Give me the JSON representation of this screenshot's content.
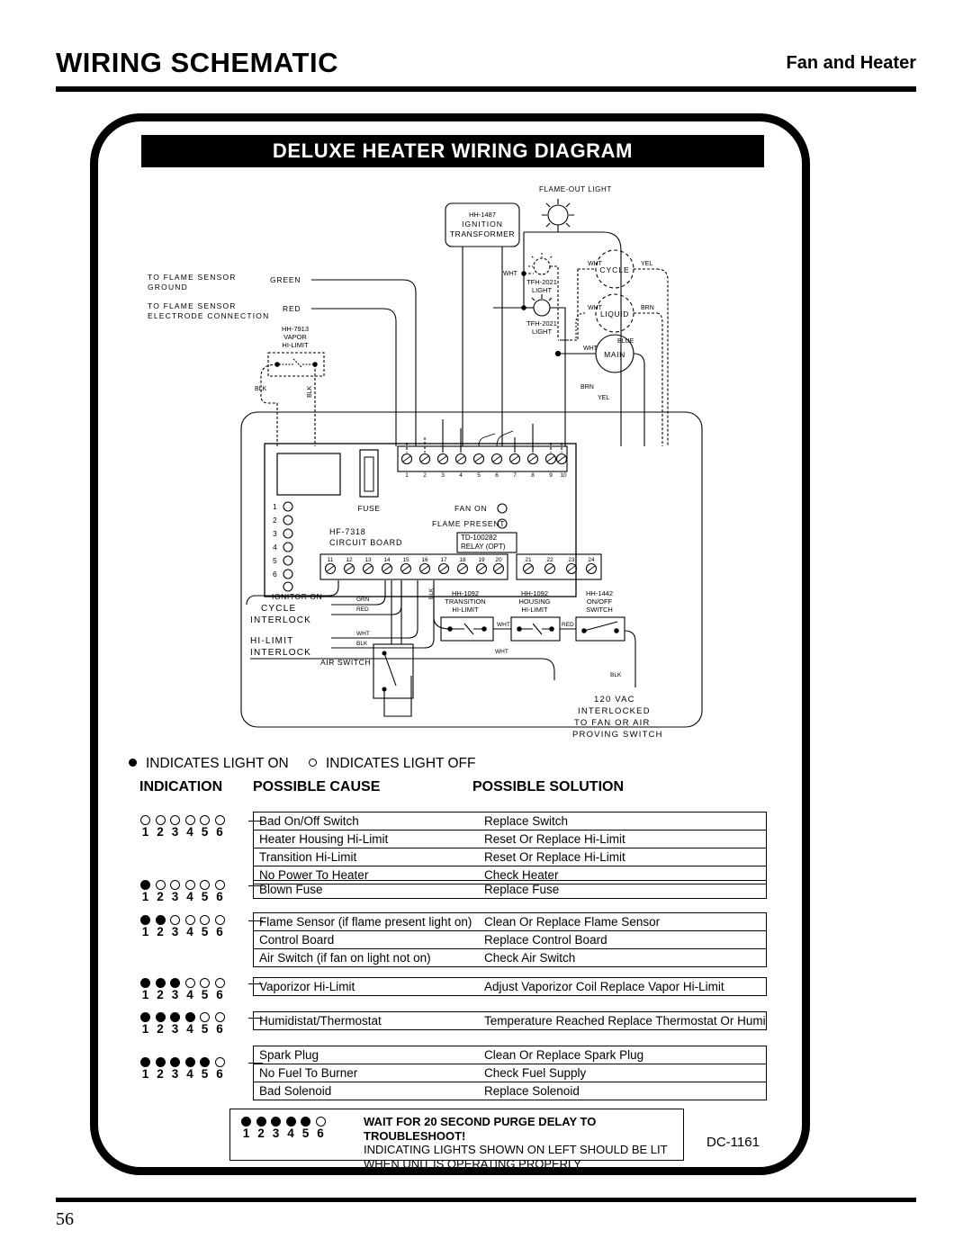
{
  "header": {
    "title": "WIRING SCHEMATIC",
    "subtitle": "Fan and Heater"
  },
  "footer": {
    "page_number": "56"
  },
  "diagram": {
    "banner_title": "DELUXE HEATER WIRING DIAGRAM",
    "drawing_number": "DC-1161",
    "components": {
      "ignition_transformer": [
        "HH-1487",
        "IGNITION",
        "TRANSFORMER"
      ],
      "flame_out_light": "FLAME-OUT LIGHT",
      "tfh_light_1": [
        "TFH-2021",
        "LIGHT"
      ],
      "tfh_light_2": [
        "TFH-2021",
        "LIGHT"
      ],
      "cycle_motor": "CYCLE",
      "liquid_motor": "LIQUID",
      "main_motor": "MAIN",
      "vapor_hi_limit": [
        "HH-7913",
        "VAPOR",
        "HI-LIMIT"
      ],
      "circuit_board": [
        "HF-7318",
        "CIRCUIT BOARD"
      ],
      "fuse": "FUSE",
      "ignitor_on": "IGNITOR ON",
      "fan_on": "FAN ON",
      "flame_present": "FLAME PRESENT",
      "relay": [
        "TD-100282",
        "RELAY (OPT)"
      ],
      "transition_hi_limit": [
        "HH-1092",
        "TRANSITION",
        "HI-LIMIT"
      ],
      "housing_hi_limit": [
        "HH-1092",
        "HOUSING",
        "HI-LIMIT"
      ],
      "on_off_switch": [
        "HH-1442",
        "ON/OFF",
        "SWITCH"
      ],
      "air_switch": "AIR SWITCH",
      "cycle_interlock": [
        "CYCLE",
        "INTERLOCK"
      ],
      "hi_limit_interlock": [
        "HI-LIMIT",
        "INTERLOCK"
      ],
      "supply_note": [
        "120 VAC",
        "INTERLOCKED",
        "TO FAN OR AIR",
        "PROVING SWITCH"
      ],
      "flame_sensor_ground": [
        "TO FLAME SENSOR",
        "GROUND"
      ],
      "flame_sensor_electrode": [
        "TO FLAME SENSOR",
        "ELECTRODE CONNECTION"
      ]
    },
    "wire_labels": {
      "green": "GREEN",
      "red": "RED",
      "wht": "WHT",
      "yel": "YEL",
      "brn": "BRN",
      "blk": "BLK",
      "blue": "BLUE",
      "grn": "GRN"
    },
    "terminal_blocks": {
      "top": [
        "1",
        "2",
        "3",
        "4",
        "5",
        "6",
        "7",
        "8",
        "9",
        "10"
      ],
      "bottom": [
        "11",
        "12",
        "13",
        "14",
        "15",
        "16",
        "17",
        "18",
        "19",
        "20"
      ],
      "relay": [
        "21",
        "22",
        "23",
        "24"
      ]
    },
    "board_lights": [
      "1",
      "2",
      "3",
      "4",
      "5",
      "6"
    ]
  },
  "legend": {
    "light_on": "INDICATES LIGHT ON",
    "light_off": "INDICATES LIGHT OFF"
  },
  "table": {
    "headers": {
      "indication": "INDICATION",
      "cause": "POSSIBLE CAUSE",
      "solution": "POSSIBLE SOLUTION"
    },
    "groups": [
      {
        "lights": [
          false,
          false,
          false,
          false,
          false,
          false
        ],
        "numbers": [
          "1",
          "2",
          "3",
          "4",
          "5",
          "6"
        ],
        "rows": [
          {
            "cause": "Bad On/Off Switch",
            "solution": "Replace Switch"
          },
          {
            "cause": "Heater Housing Hi-Limit",
            "solution": "Reset Or Replace Hi-Limit"
          },
          {
            "cause": "Transition Hi-Limit",
            "solution": "Reset Or Replace Hi-Limit"
          },
          {
            "cause": "No Power To Heater",
            "solution": "Check  Heater"
          }
        ]
      },
      {
        "lights": [
          true,
          false,
          false,
          false,
          false,
          false
        ],
        "numbers": [
          "1",
          "2",
          "3",
          "4",
          "5",
          "6"
        ],
        "rows": [
          {
            "cause": "Blown Fuse",
            "solution": "Replace Fuse"
          }
        ]
      },
      {
        "lights": [
          true,
          true,
          false,
          false,
          false,
          false
        ],
        "numbers": [
          "1",
          "2",
          "3",
          "4",
          "5",
          "6"
        ],
        "rows": [
          {
            "cause": "Flame Sensor (if flame present light on)",
            "solution": "Clean Or Replace Flame Sensor"
          },
          {
            "cause": "Control Board",
            "solution": "Replace Control Board"
          },
          {
            "cause": "Air Switch (if fan on light not on)",
            "solution": "Check Air Switch"
          }
        ]
      },
      {
        "lights": [
          true,
          true,
          true,
          false,
          false,
          false
        ],
        "numbers": [
          "1",
          "2",
          "3",
          "4",
          "5",
          "6"
        ],
        "rows": [
          {
            "cause": "Vaporizor Hi-Limit",
            "solution": "Adjust Vaporizor Coil Replace Vapor Hi-Limit"
          }
        ]
      },
      {
        "lights": [
          true,
          true,
          true,
          true,
          false,
          false
        ],
        "numbers": [
          "1",
          "2",
          "3",
          "4",
          "5",
          "6"
        ],
        "rows": [
          {
            "cause": "Humidistat/Thermostat",
            "solution": "Temperature Reached Replace Thermostat Or Humidistat"
          }
        ]
      },
      {
        "lights": [
          true,
          true,
          true,
          true,
          true,
          false
        ],
        "numbers": [
          "1",
          "2",
          "3",
          "4",
          "5",
          "6"
        ],
        "rows": [
          {
            "cause": "Spark Plug",
            "solution": "Clean Or Replace Spark Plug"
          },
          {
            "cause": "No Fuel To Burner",
            "solution": "Check Fuel Supply"
          },
          {
            "cause": "Bad Solenoid",
            "solution": "Replace Solenoid"
          }
        ]
      }
    ]
  },
  "note_box": {
    "lights": [
      true,
      true,
      true,
      true,
      true,
      false
    ],
    "numbers": [
      "1",
      "2",
      "3",
      "4",
      "5",
      "6"
    ],
    "line1": "WAIT FOR 20 SECOND PURGE DELAY TO TROUBLESHOOT!",
    "line2": "INDICATING LIGHTS SHOWN ON LEFT SHOULD BE LIT",
    "line3": "WHEN UNIT IS OPERATING PROPERLY"
  }
}
